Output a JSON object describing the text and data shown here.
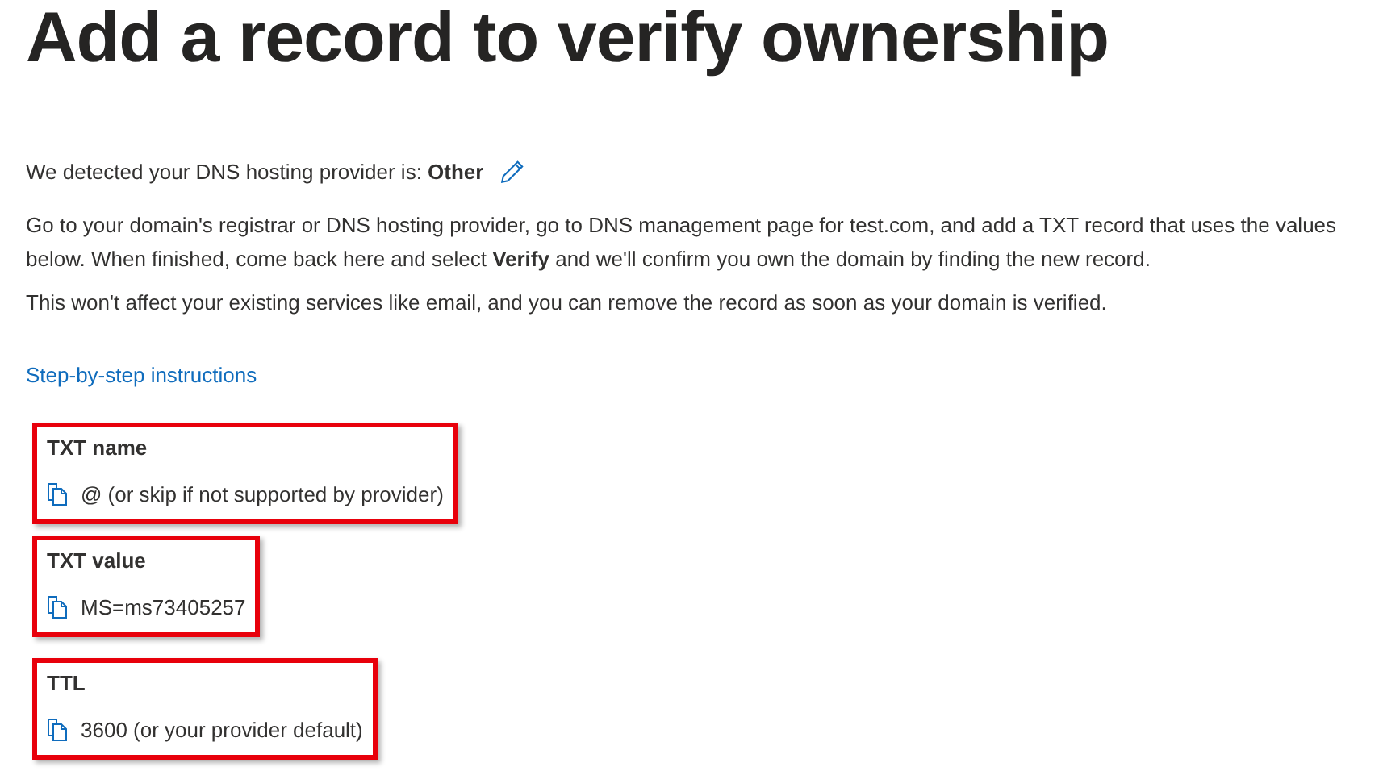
{
  "title": "Add a record to verify ownership",
  "provider_line": "We detected your DNS hosting provider is: **Other**",
  "paragraphs": [
    "Go to your domain's registrar or DNS hosting provider, go to DNS management page for test.com, and add a TXT record that uses the values below. When finished, come back here and select **Verify** and we'll confirm you own the domain by finding the new record.",
    "This won't affect your existing services like email, and you can remove the record as soon as your domain is verified."
  ],
  "instructions_link": "Step-by-step instructions",
  "records": [
    {
      "label": "TXT name",
      "value": "@ (or skip if not supported by provider)"
    },
    {
      "label": "TXT value",
      "value": "MS=ms73405257"
    },
    {
      "label": "TTL",
      "value": "3600 (or your provider default)"
    }
  ]
}
